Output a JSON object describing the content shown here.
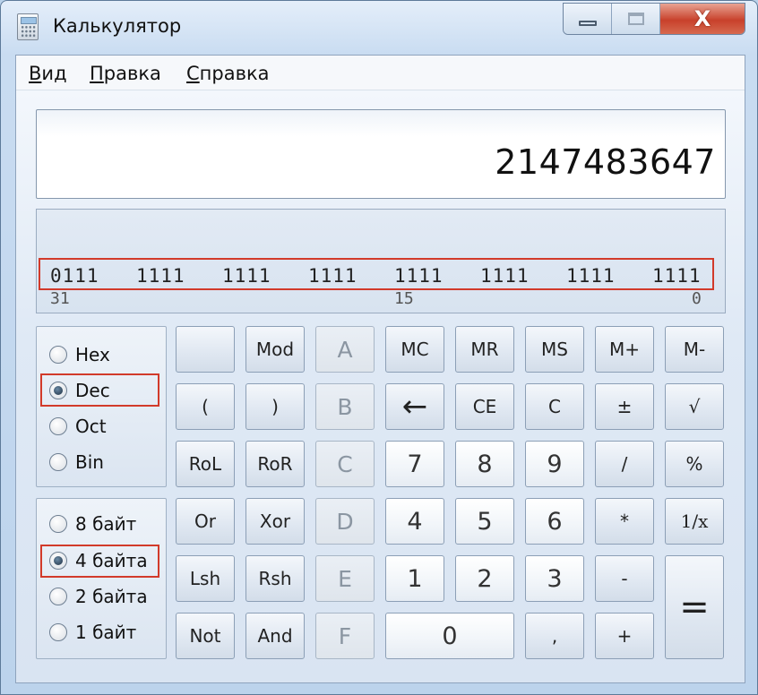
{
  "window": {
    "title": "Калькулятор",
    "icons": {
      "app": "calculator-icon",
      "minimize": "minimize-icon",
      "maximize": "maximize-icon",
      "close": "close-icon"
    },
    "close_glyph": "X"
  },
  "menu": {
    "view": {
      "first": "В",
      "rest": "ид"
    },
    "edit": {
      "first": "П",
      "rest": "равка"
    },
    "help": {
      "first": "С",
      "rest": "правка"
    }
  },
  "display": {
    "value": "2147483647"
  },
  "bits": {
    "groups": [
      "0111",
      "1111",
      "1111",
      "1111",
      "1111",
      "1111",
      "1111",
      "1111"
    ],
    "indices": [
      "31",
      "15",
      "0"
    ]
  },
  "radix": {
    "options": [
      "Hex",
      "Dec",
      "Oct",
      "Bin"
    ],
    "selected": "Dec"
  },
  "word_size": {
    "options": [
      "8 байт",
      "4 байта",
      "2 байта",
      "1 байт"
    ],
    "selected": "4 байта"
  },
  "keys": {
    "blank": "",
    "mod": "Mod",
    "a": "A",
    "b": "B",
    "c_hex": "C",
    "d": "D",
    "e": "E",
    "f": "F",
    "mc": "MC",
    "mr": "MR",
    "ms": "MS",
    "mplus": "M+",
    "mminus": "M-",
    "lparen": "(",
    "rparen": ")",
    "backspace": "←",
    "ce": "CE",
    "clear": "C",
    "plusminus": "±",
    "sqrt": "√",
    "rol": "RoL",
    "ror": "RoR",
    "seven": "7",
    "eight": "8",
    "nine": "9",
    "divide": "/",
    "percent": "%",
    "or": "Or",
    "xor": "Xor",
    "four": "4",
    "five": "5",
    "six": "6",
    "multiply": "*",
    "reciprocal": "1/x",
    "lsh": "Lsh",
    "rsh": "Rsh",
    "one": "1",
    "two": "2",
    "three": "3",
    "minus": "-",
    "equals": "=",
    "not": "Not",
    "and": "And",
    "zero": "0",
    "decimal": ",",
    "plus": "+"
  },
  "colors": {
    "highlight_border": "#d23a2a",
    "window_bg": "#c9dcf1",
    "close_button": "#c8412b"
  }
}
